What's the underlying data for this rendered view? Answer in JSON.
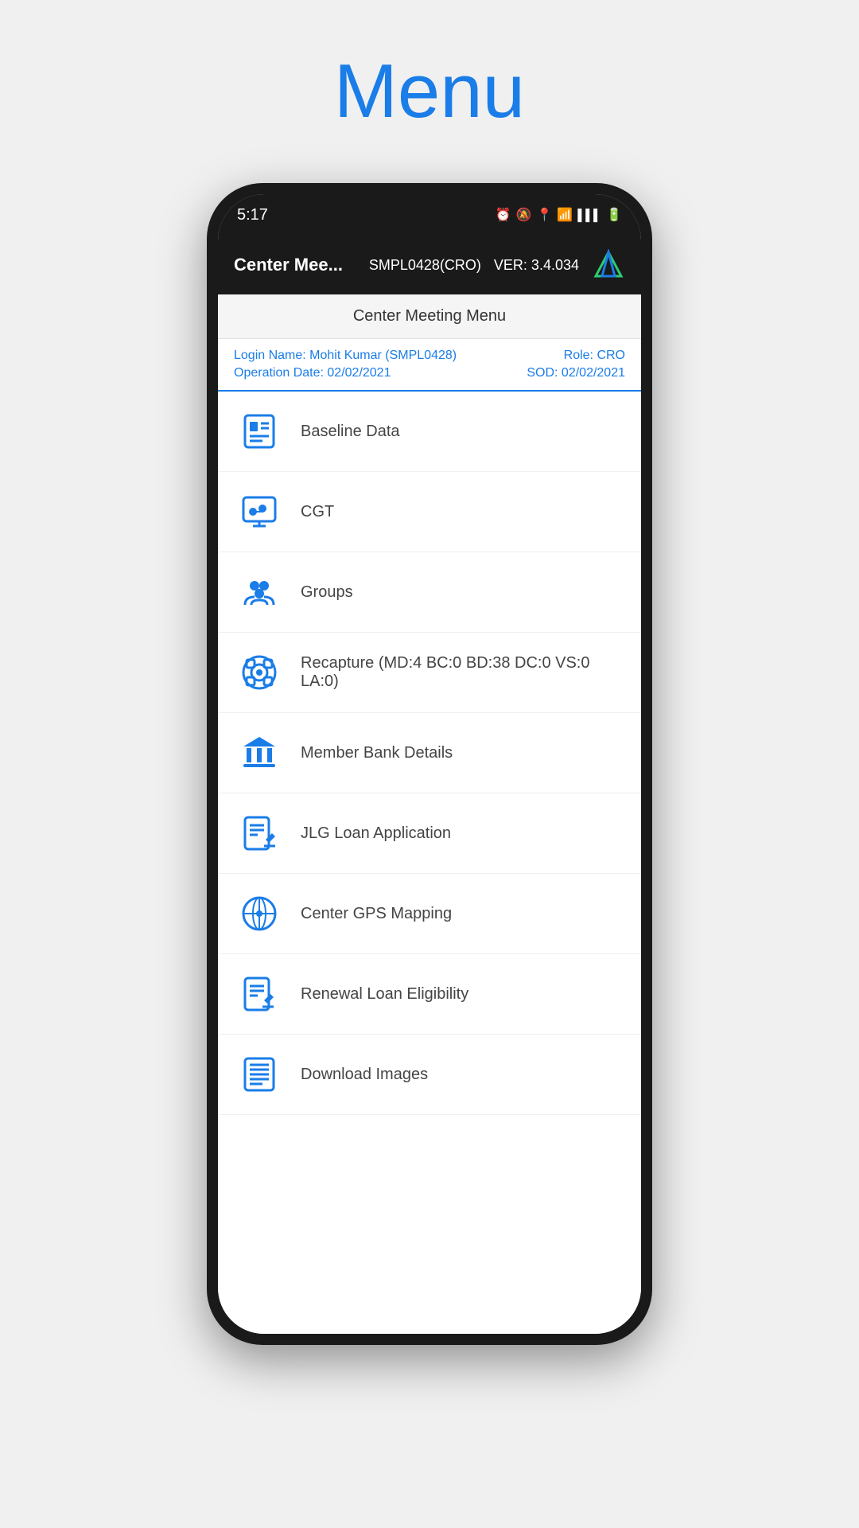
{
  "page": {
    "title": "Menu"
  },
  "status_bar": {
    "time": "5:17",
    "icons": [
      "⏰",
      "🔕",
      "📍",
      "📶",
      "📱",
      "🔋"
    ]
  },
  "app_header": {
    "title": "Center Mee...",
    "user": "SMPL0428(CRO)",
    "version": "VER: 3.4.034"
  },
  "menu_title": "Center Meeting Menu",
  "user_info": {
    "login_label": "Login Name: Mohit Kumar (SMPL0428)",
    "operation_label": "Operation Date: 02/02/2021",
    "role_label": "Role: CRO",
    "sod_label": "SOD: 02/02/2021"
  },
  "menu_items": [
    {
      "id": "baseline-data",
      "label": "Baseline Data",
      "icon": "baseline"
    },
    {
      "id": "cgt",
      "label": "CGT",
      "icon": "cgt"
    },
    {
      "id": "groups",
      "label": "Groups",
      "icon": "groups"
    },
    {
      "id": "recapture",
      "label": "Recapture (MD:4  BC:0 BD:38 DC:0 VS:0 LA:0)",
      "icon": "recapture"
    },
    {
      "id": "member-bank-details",
      "label": "Member Bank Details",
      "icon": "bank"
    },
    {
      "id": "jlg-loan-application",
      "label": "JLG Loan Application",
      "icon": "loan-app"
    },
    {
      "id": "center-gps-mapping",
      "label": "Center GPS Mapping",
      "icon": "gps"
    },
    {
      "id": "renewal-loan-eligibility",
      "label": "Renewal Loan Eligibility",
      "icon": "renewal"
    },
    {
      "id": "download-images",
      "label": "Download Images",
      "icon": "download"
    }
  ]
}
